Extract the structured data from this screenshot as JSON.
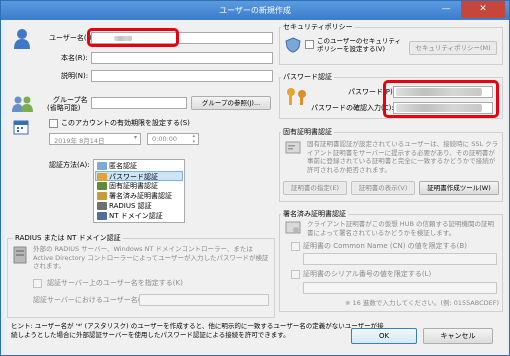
{
  "window": {
    "title": "ユーザーの新規作成",
    "min": "—",
    "close": "✕"
  },
  "user": {
    "username_label": "ユーザー名(U):",
    "realname_label": "本名(R):",
    "description_label": "説明(N):",
    "group_label": "グループ名",
    "group_sublabel": "(省略可能)",
    "group_browse": "グループの参照(J)...",
    "expire_label": "このアカウントの有効期限を設定する(S)",
    "expire_date": "2019年  8月14日",
    "expire_time": "0:00:00"
  },
  "auth": {
    "label": "認証方法(A):",
    "methods": [
      "匿名認証",
      "パスワード認証",
      "固有証明書認証",
      "署名済み証明書認証",
      "RADIUS 認証",
      "NT ドメイン認証"
    ],
    "selected": "パスワード認証"
  },
  "radius": {
    "group_title": "RADIUS または NT ドメイン認証",
    "description": "外部の RADIUS サーバー、Windows NT ドメインコントローラー、または Active Directory コントローラーによってユーザーが入力したパスワードが検証されます。",
    "specify_check": "認証サーバー上のユーザー名を指定する(K)",
    "server_username_label": "認証サーバーにおけるユーザー名(T):"
  },
  "security": {
    "group_title": "セキュリティポリシー",
    "check": "このユーザーのセキュリティポリシーを設定する(V)",
    "button": "セキュリティポリシー(M)"
  },
  "password": {
    "group_title": "パスワード認証",
    "password_label": "パスワード(P):",
    "confirm_label": "パスワードの確認入力(C):"
  },
  "certificate": {
    "group_title": "固有証明書認証",
    "description": "固有証明書認証が設定されているユーザーは、接続時に SSL クライアント証明書をサーバーに提示する必要があり、その証明書が事前に登録されている証明書と完全に一致するかどうかで接続が許可されるか拒否されます。",
    "btn_specify": "証明書の指定(E)",
    "btn_view": "証明書の表示(V)",
    "btn_tool": "証明書作成ツール(W)"
  },
  "signed": {
    "group_title": "署名済み証明書認証",
    "description": "クライアント証明書がこの仮想 HUB の信頼する証明機関の証明書によって署名されているかどうかを検証します。",
    "cn_check": "証明書の Common Name (CN) の値を限定する(B)",
    "serial_check": "証明書のシリアル番号の値を限定する(L)",
    "serial_note": "※ 16 進数で入力してください。(例: 0155ABCDEF)"
  },
  "footer": {
    "hint": "ヒント: ユーザー名が '*' (アスタリスク) のユーザーを作成すると、他に明示的に一致するユーザー名の定義がないユーザーが接続しようとした場合に外部認証サーバーを使用したパスワード認証による接続を許可できます。",
    "ok": "OK",
    "cancel": "キャンセル"
  }
}
